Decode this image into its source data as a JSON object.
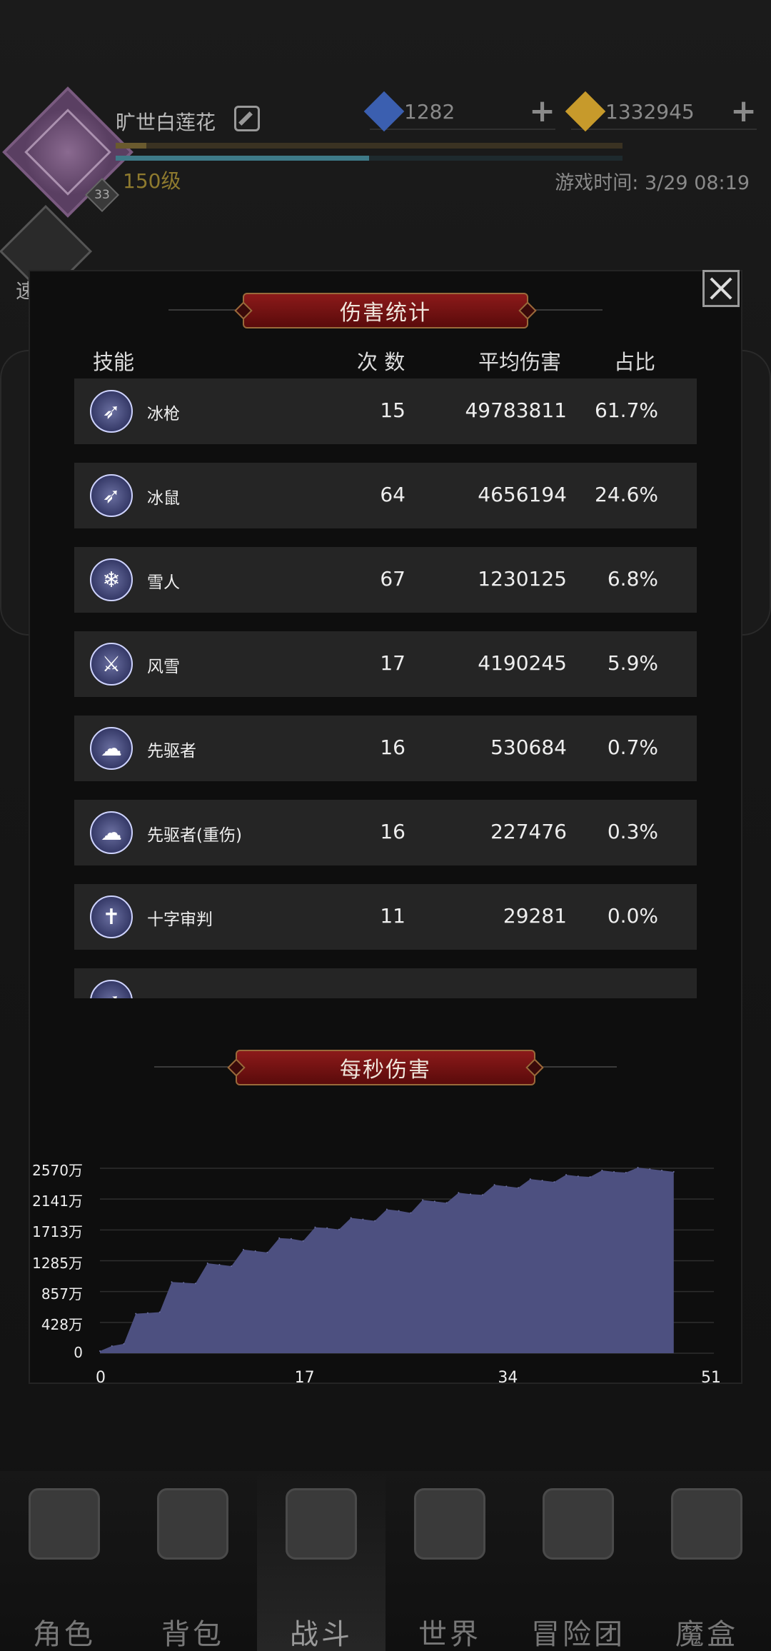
{
  "header": {
    "player_name": "旷世白莲花",
    "level_badge": "33",
    "player_level": "150级",
    "game_time": "游戏时间: 3/29 08:19",
    "xp_progress": 0.06,
    "mp_progress": 0.5,
    "currencies": [
      {
        "name": "blue-gem",
        "value": "1282",
        "color": "#3b5fb0"
      },
      {
        "name": "gold-gem",
        "value": "1332945",
        "color": "#c79a2b"
      }
    ],
    "quick_battle_label": "速 战"
  },
  "modal": {
    "title": "伤害统计",
    "columns": [
      "技能",
      "次 数",
      "平均伤害",
      "占比"
    ],
    "rows": [
      {
        "icon": "arrows-icon",
        "glyph": "➶",
        "name": "冰枪",
        "count": "15",
        "avg": "49783811",
        "pct": "61.7%"
      },
      {
        "icon": "arrows-icon",
        "glyph": "➶",
        "name": "冰鼠",
        "count": "64",
        "avg": "4656194",
        "pct": "24.6%"
      },
      {
        "icon": "snowflake-icon",
        "glyph": "❄",
        "name": "雪人",
        "count": "67",
        "avg": "1230125",
        "pct": "6.8%"
      },
      {
        "icon": "sword-icon",
        "glyph": "⚔",
        "name": "风雪",
        "count": "17",
        "avg": "4190245",
        "pct": "5.9%"
      },
      {
        "icon": "mushroom-cloud-icon",
        "glyph": "☁",
        "name": "先驱者",
        "count": "16",
        "avg": "530684",
        "pct": "0.7%"
      },
      {
        "icon": "mushroom-cloud-icon",
        "glyph": "☁",
        "name": "先驱者(重伤)",
        "count": "16",
        "avg": "227476",
        "pct": "0.3%"
      },
      {
        "icon": "banner-cross-icon",
        "glyph": "✝",
        "name": "十字审判",
        "count": "11",
        "avg": "29281",
        "pct": "0.0%"
      },
      {
        "icon": "arrows-icon",
        "glyph": "➶",
        "name": "",
        "count": "",
        "avg": "",
        "pct": ""
      }
    ],
    "dps_title": "每秒伤害"
  },
  "chart_data": {
    "type": "area",
    "title": "每秒伤害",
    "yticks": [
      "0",
      "428万",
      "857万",
      "1285万",
      "1713万",
      "2141万",
      "2570万"
    ],
    "xticks": [
      "0",
      "17",
      "34",
      "51"
    ],
    "ylim": [
      0,
      2570
    ],
    "xlim": [
      0,
      51
    ],
    "color": "#4d5080",
    "x": [
      0,
      1,
      2,
      3,
      4,
      5,
      6,
      7,
      8,
      9,
      10,
      11,
      12,
      13,
      14,
      15,
      16,
      17,
      18,
      19,
      20,
      21,
      22,
      23,
      24,
      25,
      26,
      27,
      28,
      29,
      30,
      31,
      32,
      33,
      34,
      35,
      36,
      37,
      38,
      39,
      40,
      41,
      42,
      43,
      44,
      45,
      46,
      47,
      48
    ],
    "values": [
      30,
      100,
      130,
      550,
      560,
      570,
      990,
      980,
      970,
      1250,
      1230,
      1210,
      1440,
      1420,
      1400,
      1600,
      1590,
      1560,
      1750,
      1740,
      1720,
      1880,
      1860,
      1840,
      2000,
      1980,
      1950,
      2130,
      2110,
      2090,
      2230,
      2210,
      2200,
      2340,
      2320,
      2300,
      2420,
      2400,
      2380,
      2480,
      2460,
      2450,
      2540,
      2520,
      2510,
      2580,
      2560,
      2540,
      2520
    ]
  },
  "nav": [
    {
      "label": "角色",
      "icon": "helmet-icon",
      "active": false
    },
    {
      "label": "背包",
      "icon": "backpack-icon",
      "active": false
    },
    {
      "label": "战斗",
      "icon": "sword-shield-icon",
      "active": true
    },
    {
      "label": "世界",
      "icon": "map-scroll-icon",
      "active": false
    },
    {
      "label": "冒险团",
      "icon": "castle-icon",
      "active": false
    },
    {
      "label": "魔盒",
      "icon": "magic-cube-icon",
      "active": false
    }
  ]
}
